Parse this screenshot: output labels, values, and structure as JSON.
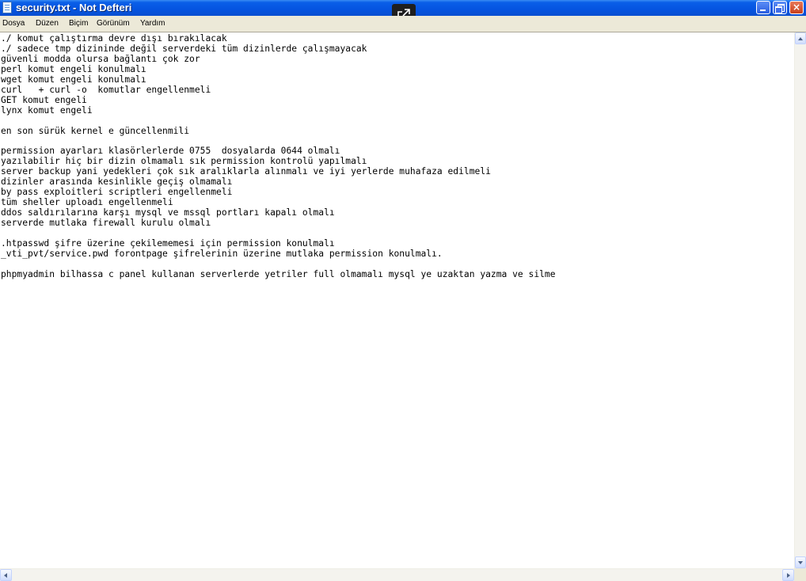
{
  "window": {
    "title": "security.txt - Not Defteri",
    "close_symbol": "×",
    "icons": {
      "app": "notepad-icon",
      "popout": "external-link-icon",
      "minimize": "minimize-icon",
      "maximize": "restore-icon",
      "close": "close-icon"
    },
    "colors": {
      "titlebar": "#0554e0",
      "menubar": "#ece9d8",
      "close_button": "#c8401c"
    }
  },
  "menu": {
    "items": [
      {
        "label": "Dosya"
      },
      {
        "label": "Düzen"
      },
      {
        "label": "Biçim"
      },
      {
        "label": "Görünüm"
      },
      {
        "label": "Yardım"
      }
    ]
  },
  "editor": {
    "lines": [
      "./ komut çalıştırma devre dışı bırakılacak",
      "./ sadece tmp dizininde değil serverdeki tüm dizinlerde çalışmayacak",
      "güvenli modda olursa bağlantı çok zor",
      "perl komut engeli konulmalı",
      "wget komut engeli konulmalı",
      "curl   + curl -o  komutlar engellenmeli",
      "GET komut engeli",
      "lynx komut engeli",
      "",
      "en son sürük kernel e güncellenmili",
      "",
      "permission ayarları klasörlerlerde 0755  dosyalarda 0644 olmalı",
      "yazılabilir hiç bir dizin olmamalı sık permission kontrolü yapılmalı",
      "server backup yani yedekleri çok sık aralıklarla alınmalı ve iyi yerlerde muhafaza edilmeli",
      "dizinler arasında kesinlikle geçiş olmamalı",
      "by pass exploitleri scriptleri engellenmeli",
      "tüm sheller uploadı engellenmeli",
      "ddos saldırılarına karşı mysql ve mssql portları kapalı olmalı",
      "serverde mutlaka firewall kurulu olmalı",
      "",
      ".htpasswd şifre üzerine çekilememesi için permission konulmalı",
      "_vti_pvt/service.pwd forontpage şifrelerinin üzerine mutlaka permission konulmalı.",
      "",
      "phpmyadmin bilhassa c panel kullanan serverlerde yetriler full olmamalı mysql ye uzaktan yazma ve silme"
    ]
  },
  "scrollbars": {
    "icons": {
      "up": "arrow-up-icon",
      "down": "arrow-down-icon",
      "left": "arrow-left-icon",
      "right": "arrow-right-icon"
    }
  }
}
